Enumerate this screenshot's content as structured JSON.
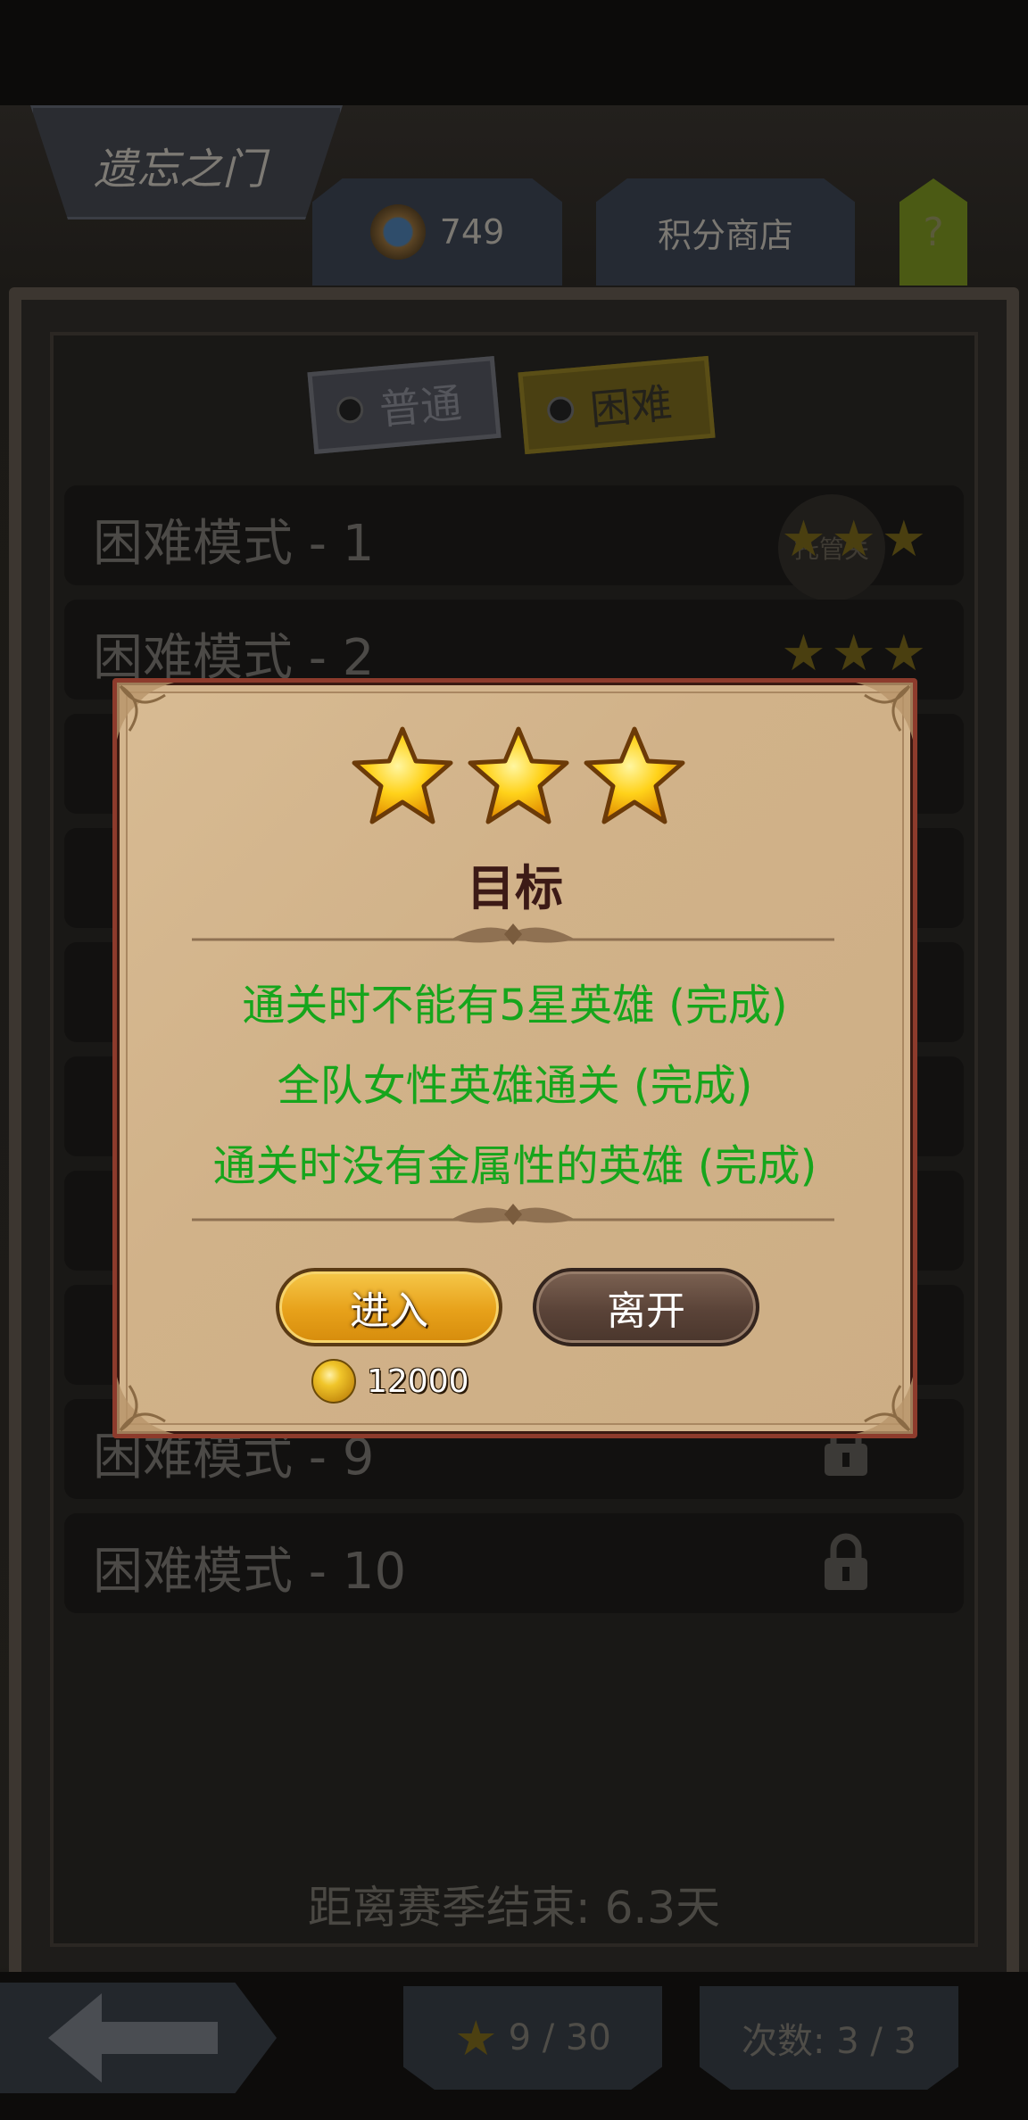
{
  "header": {
    "title": "遗忘之门",
    "points_value": "749",
    "shop_label": "积分商店",
    "help_label": "?"
  },
  "mode_tabs": {
    "normal_label": "普通",
    "hard_label": "困难",
    "selected": "困难"
  },
  "levels": [
    {
      "label": "困难模式 - 1",
      "stars": 3,
      "auto_label": "托管关"
    },
    {
      "label": "困难模式 - 2",
      "stars": 3
    },
    {
      "label": "困难模式 - 9",
      "locked": true
    },
    {
      "label": "困难模式 - 10",
      "locked": true
    }
  ],
  "season": {
    "text": "距离赛季结束: 6.3天"
  },
  "footer": {
    "stars_text": "9 / 30",
    "count_text": "次数: 3 / 3"
  },
  "dialog": {
    "stars_earned": 3,
    "title": "目标",
    "goals": [
      "通关时不能有5星英雄 (完成)",
      "全队女性英雄通关 (完成)",
      "通关时没有金属性的英雄 (完成)"
    ],
    "enter_label": "进入",
    "leave_label": "离开",
    "cost_value": "12000"
  },
  "colors": {
    "goal_text": "#16a51c",
    "dialog_bg": "#d1b289",
    "enter_button": "#e7a11a",
    "leave_button": "#5a4338"
  },
  "icons": [
    "medal-icon",
    "star-icon",
    "lock-icon",
    "back-arrow-icon",
    "coin-icon",
    "help-icon"
  ]
}
